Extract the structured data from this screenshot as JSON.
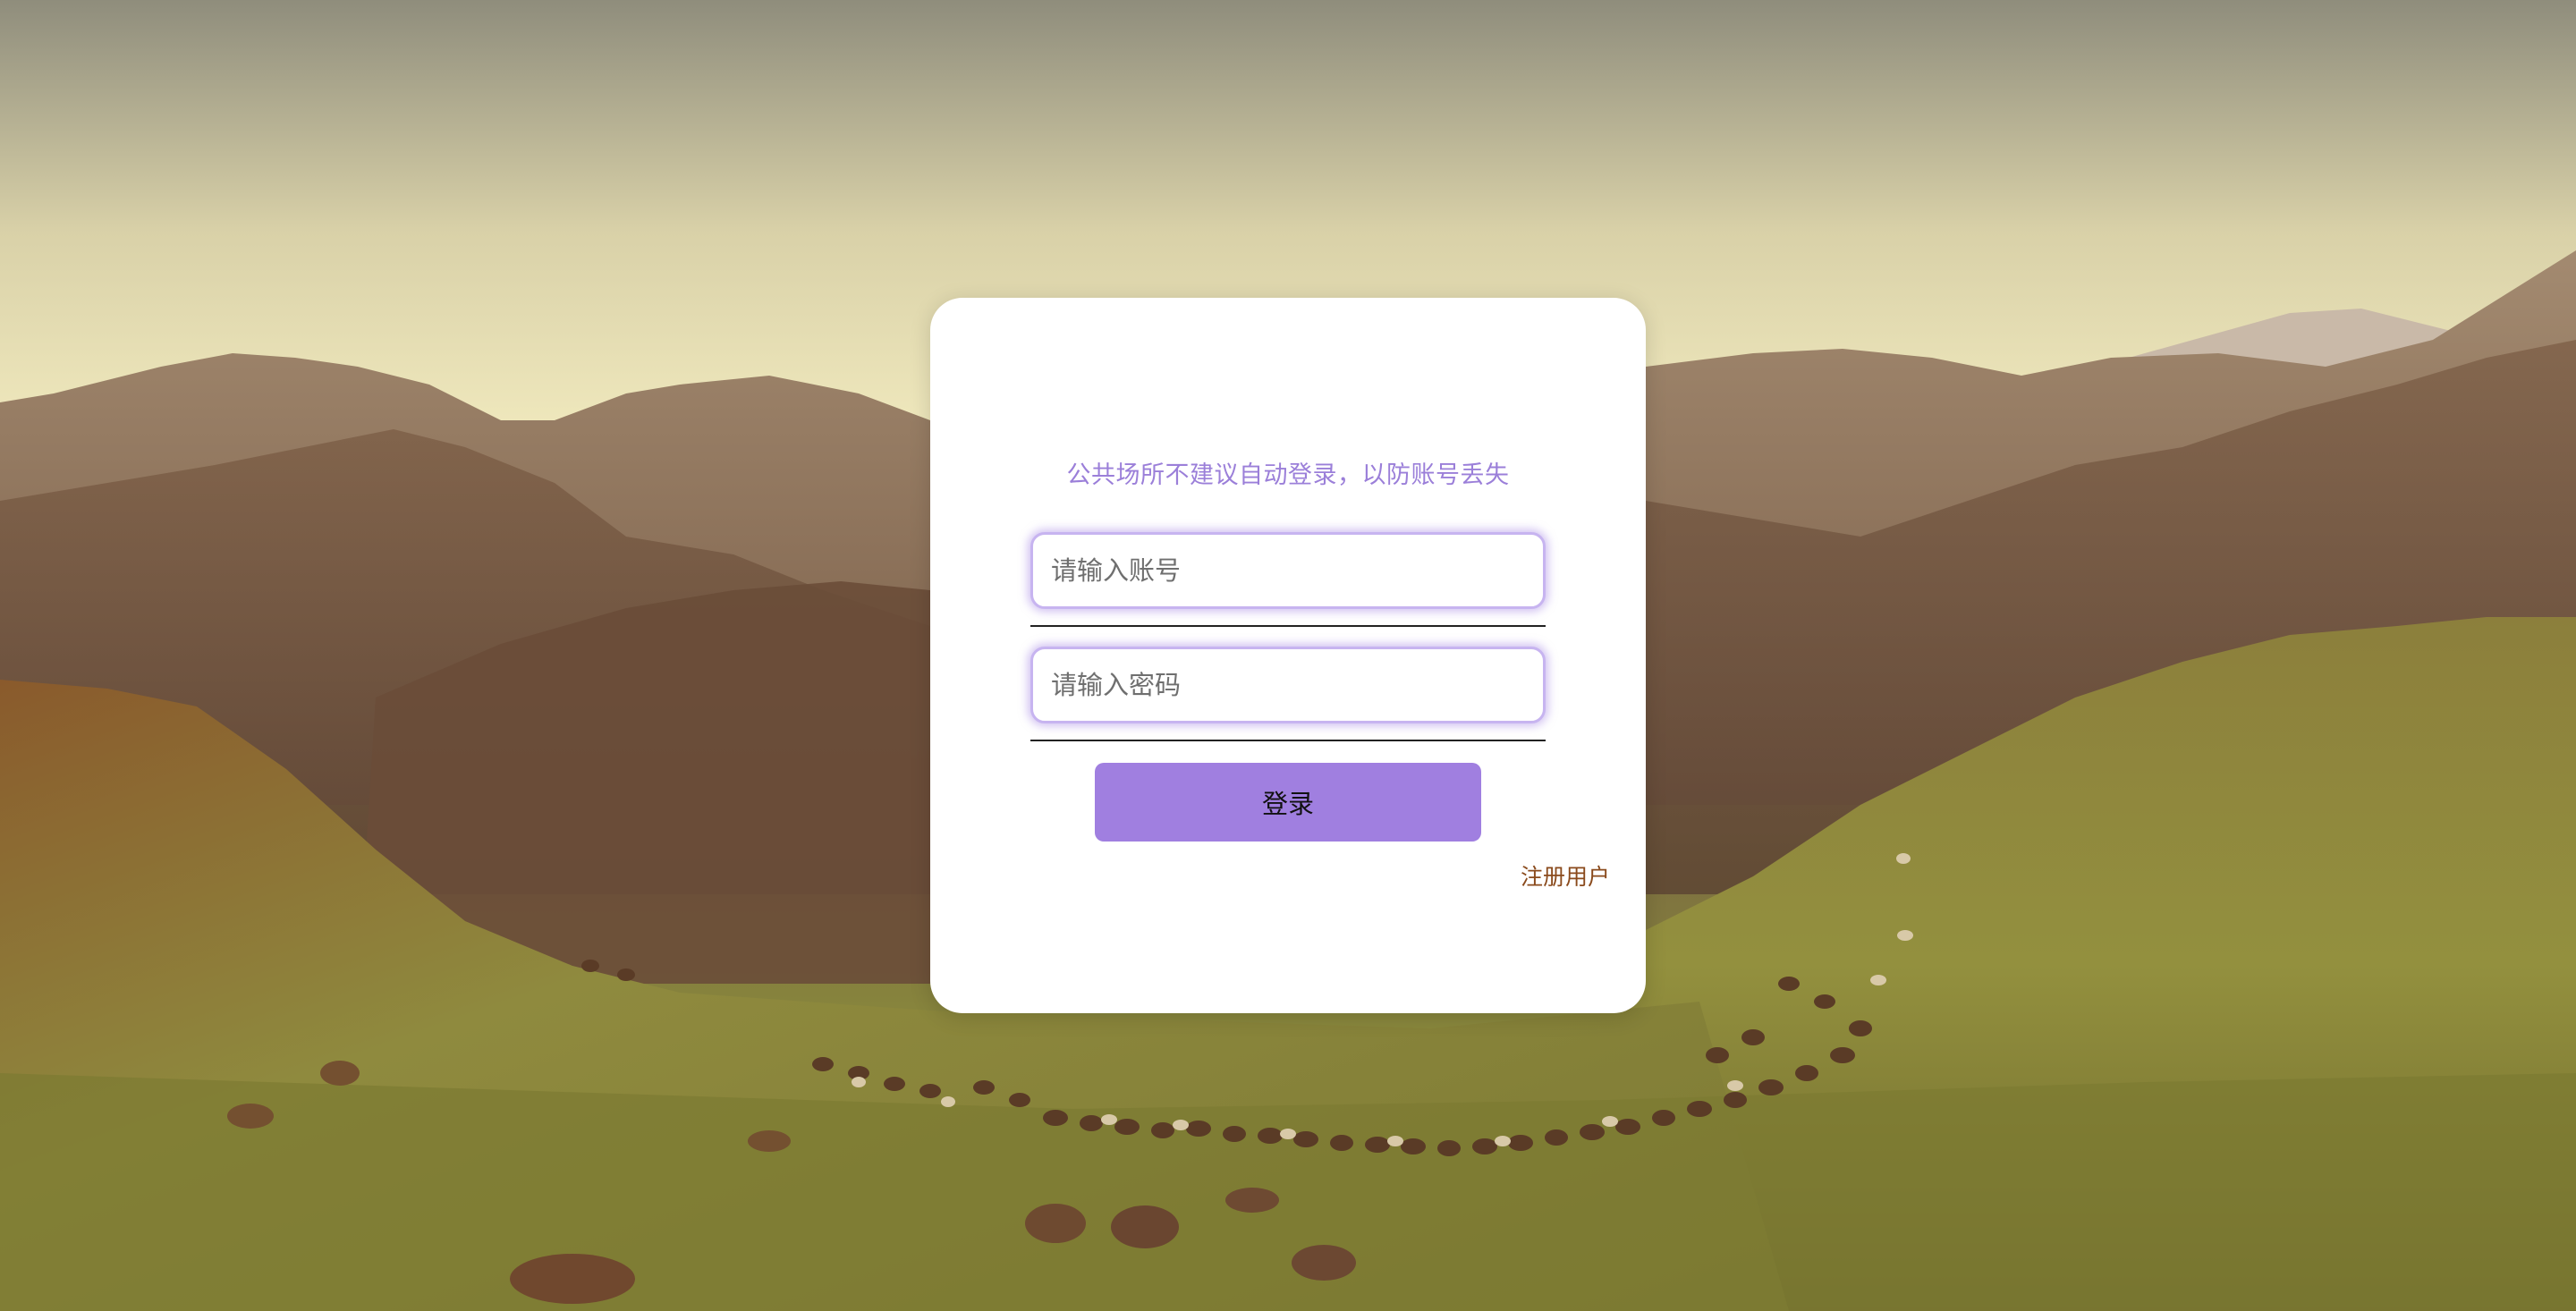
{
  "login": {
    "notice": "公共场所不建议自动登录，以防账号丢失",
    "account_placeholder": "请输入账号",
    "password_placeholder": "请输入密码",
    "account_value": "",
    "password_value": "",
    "submit_label": "登录",
    "register_label": "注册用户"
  },
  "theme": {
    "accent": "#a07fe0",
    "notice_color": "#9b7fd9",
    "link_color": "#8a4a1c",
    "card_background": "#ffffff"
  },
  "background": {
    "description_icon": "mountain-landscape-image"
  }
}
